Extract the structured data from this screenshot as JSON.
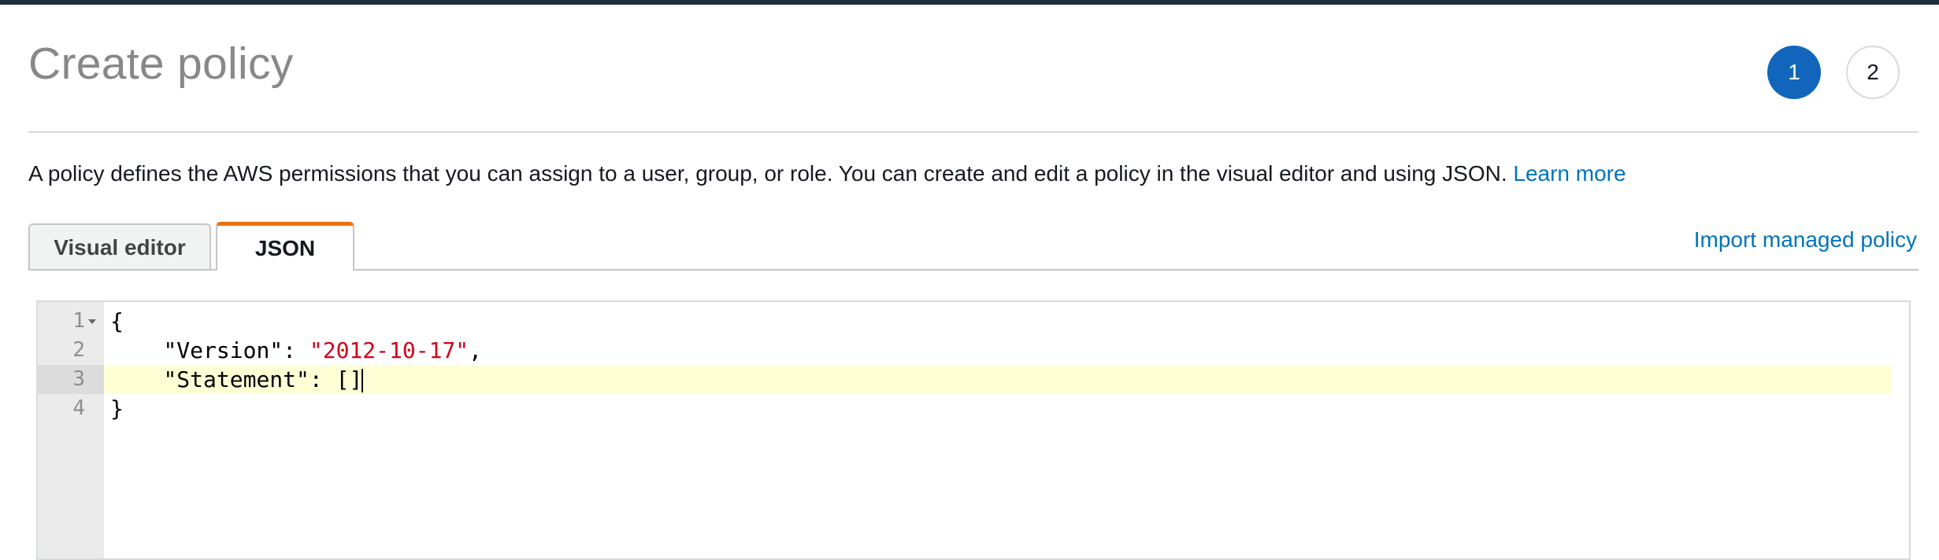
{
  "header": {
    "title": "Create policy",
    "steps": [
      "1",
      "2"
    ],
    "active_step": "1"
  },
  "intro": {
    "text": "A policy defines the AWS permissions that you can assign to a user, group, or role. You can create and edit a policy in the visual editor and using JSON.",
    "learn_more": "Learn more"
  },
  "tabs": {
    "visual_editor": "Visual editor",
    "json": "JSON",
    "active": "JSON"
  },
  "import_link": "Import managed policy",
  "editor": {
    "lines": [
      {
        "num": "1",
        "text": "{"
      },
      {
        "num": "2",
        "key": "\"Version\"",
        "sep": ": ",
        "value": "\"2012-10-17\"",
        "tail": ","
      },
      {
        "num": "3",
        "key": "\"Statement\"",
        "sep": ": ",
        "value": "[]",
        "tail": ""
      },
      {
        "num": "4",
        "text": "}"
      }
    ],
    "current_line": "3"
  },
  "colors": {
    "accent_orange": "#ec7211",
    "link_blue": "#0073bb",
    "step_active": "#1166bb",
    "string_red": "#d0021b",
    "current_line_bg": "#ffffd6"
  }
}
